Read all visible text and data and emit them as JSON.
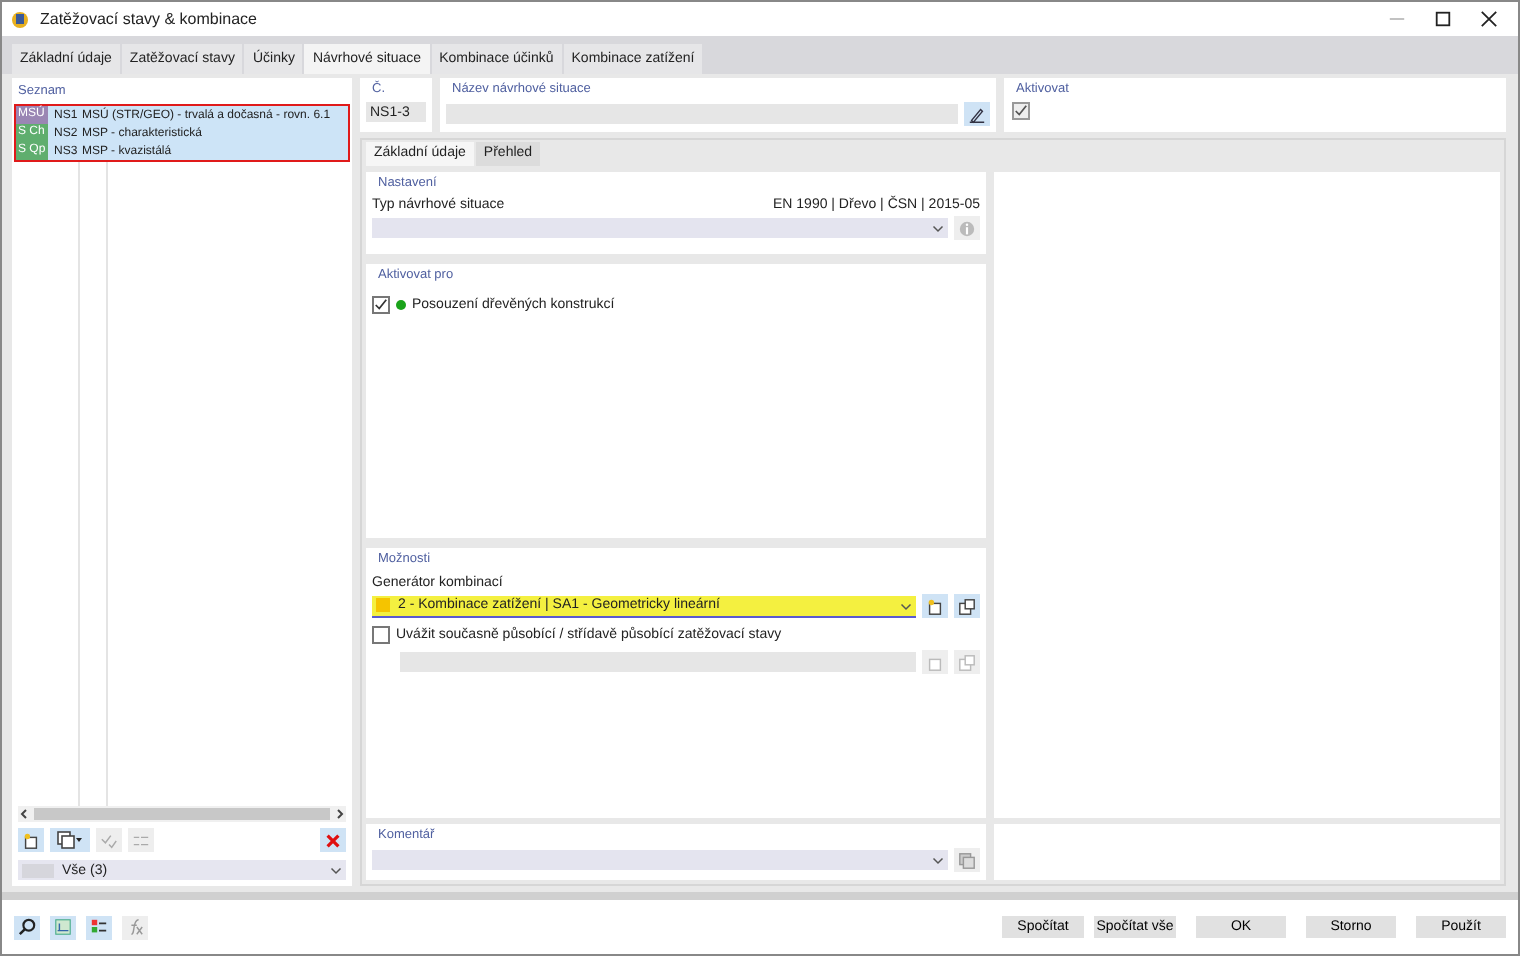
{
  "window": {
    "title": "Zatěžovací stavy & kombinace"
  },
  "tabs": [
    {
      "label": "Základní údaje",
      "selected": false
    },
    {
      "label": "Zatěžovací stavy",
      "selected": false
    },
    {
      "label": "Účinky",
      "selected": false
    },
    {
      "label": "Návrhové situace",
      "selected": true
    },
    {
      "label": "Kombinace účinků",
      "selected": false
    },
    {
      "label": "Kombinace zatížení",
      "selected": false
    }
  ],
  "list": {
    "title": "Seznam",
    "items": [
      {
        "tag": "MSÚ",
        "color": "#9a86b4",
        "id": "NS1",
        "name": "MSÚ (STR/GEO) - trvalá a dočasná - rovn. 6.1",
        "selected": true
      },
      {
        "tag": "S Ch",
        "color": "#5fae6e",
        "id": "NS2",
        "name": "MSP - charakteristická",
        "selected": true
      },
      {
        "tag": "S Qp",
        "color": "#5fae6e",
        "id": "NS3",
        "name": "MSP - kvazistálá",
        "selected": true
      }
    ],
    "filter": "Vše (3)"
  },
  "number": {
    "label": "Č.",
    "value": "NS1-3"
  },
  "name": {
    "label": "Název návrhové situace"
  },
  "activate": {
    "label": "Aktivovat",
    "checked": true
  },
  "subtabs": [
    {
      "label": "Základní údaje",
      "selected": true
    },
    {
      "label": "Přehled",
      "selected": false
    }
  ],
  "settings": {
    "title": "Nastavení",
    "type_label": "Typ návrhové situace",
    "standard": "EN 1990 | Dřevo | ČSN | 2015-05"
  },
  "activate_for": {
    "title": "Aktivovat pro",
    "items": [
      {
        "label": "Posouzení dřevěných konstrukcí",
        "checked": true,
        "color": "#1aa31a"
      }
    ]
  },
  "options": {
    "title": "Možnosti",
    "generator": {
      "label": "Generátor kombinací",
      "items": [
        {
          "value": "2 - Kombinace zatížení | SA1 - Geometricky lineární",
          "color": "#f5c400"
        }
      ]
    },
    "simultaneous": {
      "label": "Uvážit současně působící / střídavě působící zatěžovací stavy",
      "checked": false
    }
  },
  "comment": {
    "label": "Komentář"
  },
  "buttons": [
    "Spočítat",
    "Spočítat vše",
    "OK",
    "Storno",
    "Použít"
  ]
}
